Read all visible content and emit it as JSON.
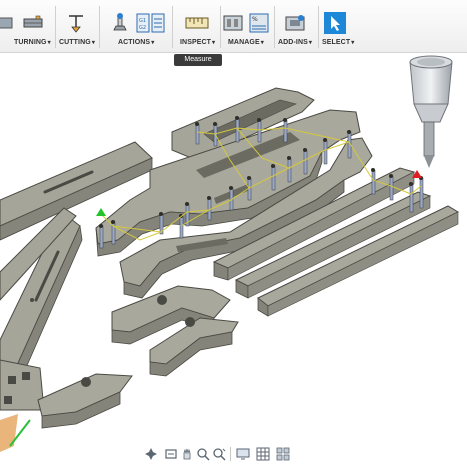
{
  "toolbar": {
    "groups": [
      {
        "label": "TURNING",
        "icon": "turning-icon"
      },
      {
        "label": "CUTTING",
        "icon": "cutting-icon"
      },
      {
        "label": "ACTIONS",
        "icon": "actions-icon"
      },
      {
        "label": "INSPECT",
        "icon": "measure-icon"
      },
      {
        "label": "MANAGE",
        "icon": "manage-icon"
      },
      {
        "label": "ADD-INS",
        "icon": "add-ins-icon"
      },
      {
        "label": "SELECT",
        "icon": "select-icon"
      }
    ]
  },
  "tooltip": {
    "text": "Measure"
  },
  "colors": {
    "accent": "#1e88d8",
    "part_top": "#a7a69b",
    "part_side": "#8a8a80",
    "toolpath": "#d4c93a",
    "start_marker": "#22c42a",
    "end_marker": "#e02020"
  },
  "navbar": {
    "icons": [
      "orbit-icon",
      "pan-icon",
      "hand-icon",
      "zoom-icon",
      "zoom-window-icon",
      "display-icon",
      "grid-icon",
      "viewports-icon"
    ]
  }
}
